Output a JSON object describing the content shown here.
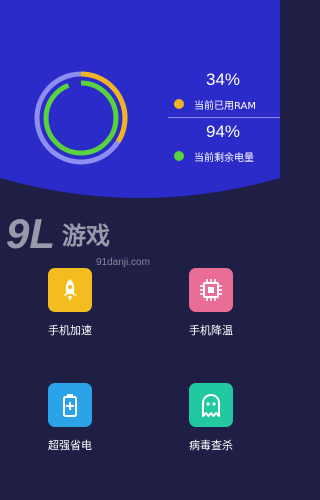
{
  "header": {
    "colors": {
      "background": "#2a2bc9",
      "body": "#1f1e45"
    }
  },
  "memory_ring": {
    "ram_used_fraction": 0.34,
    "battery_fraction": 0.94,
    "colors": {
      "ram": "#f0b323",
      "battery": "#58d23d",
      "track": "#8e8df0"
    }
  },
  "stats": [
    {
      "percent": "34%",
      "label": "当前已用RAM",
      "dot_color": "#f0b323",
      "icon": "ram-dot"
    },
    {
      "percent": "94%",
      "label": "当前剩余电量",
      "dot_color": "#58d23d",
      "icon": "battery-dot"
    }
  ],
  "watermark": {
    "logo": "9L游戏",
    "site": "91danji.com"
  },
  "features": [
    {
      "label": "手机加速",
      "icon": "rocket-icon",
      "color": "#f3bd1f"
    },
    {
      "label": "手机降温",
      "icon": "chip-icon",
      "color": "#ea6d96"
    },
    {
      "label": "超强省电",
      "icon": "battery-icon",
      "color": "#2ba3e8"
    },
    {
      "label": "病毒查杀",
      "icon": "ghost-icon",
      "color": "#22c9a0"
    }
  ]
}
